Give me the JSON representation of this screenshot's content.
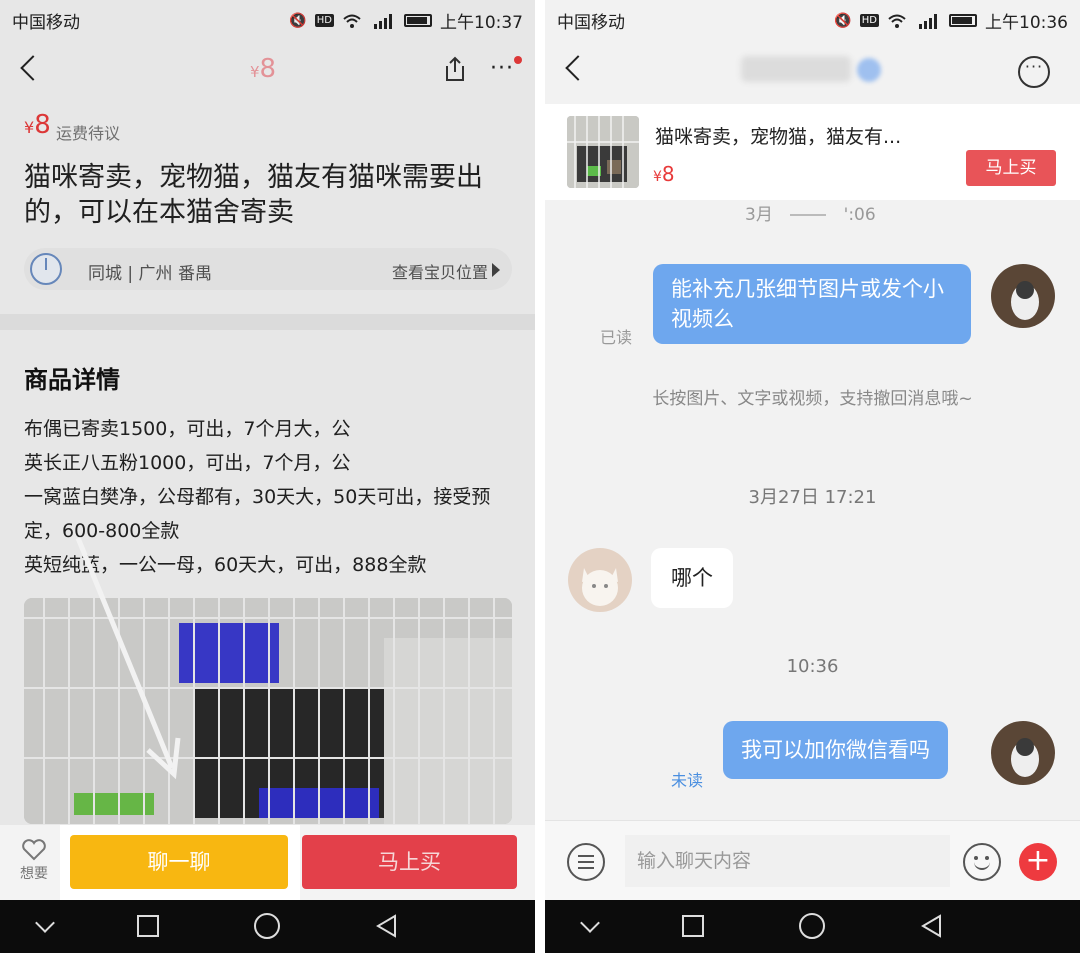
{
  "left": {
    "status": {
      "carrier": "中国移动",
      "time": "上午10:37",
      "hd": "HD",
      "signal": "⁴⁶"
    },
    "nav": {
      "price_symbol": "¥",
      "price": "8"
    },
    "product": {
      "price_symbol": "¥",
      "price": "8",
      "shipping": "运费待议",
      "title": "猫咪寄卖，宠物猫，猫友有猫咪需要出的，可以在本猫舍寄卖"
    },
    "location": {
      "text": "同城 | 广州 番禺",
      "link": "查看宝贝位置"
    },
    "details": {
      "heading": "商品详情",
      "lines": [
        "布偶已寄卖1500，可出，7个月大，公",
        "英长正八五粉1000，可出，7个月，公",
        "一窝蓝白樊净，公母都有，30天大，50天可出，接受预定，600-800全款",
        "英短纯蓝，一公一母，60天大，可出，888全款"
      ]
    },
    "bottom": {
      "want_label": "想要",
      "chat_label": "聊一聊",
      "buy_label": "马上买"
    }
  },
  "right": {
    "status": {
      "carrier": "中国移动",
      "time": "上午10:36",
      "hd": "HD",
      "signal": "⁴⁶"
    },
    "product_card": {
      "title": "猫咪寄卖，宠物猫，猫友有...",
      "price_symbol": "¥",
      "price": "8",
      "buy_label": "马上买"
    },
    "partial_time": "3月",
    "partial_time_tail": "':06",
    "messages": [
      {
        "side": "me",
        "text": "能补充几张细节图片或发个小视频么",
        "status": "已读"
      },
      {
        "side": "system",
        "text": "长按图片、文字或视频，支持撤回消息哦~"
      },
      {
        "side": "time",
        "text": "3月27日 17:21"
      },
      {
        "side": "other",
        "text": "哪个"
      },
      {
        "side": "time",
        "text": "10:36"
      },
      {
        "side": "me",
        "text": "我可以加你微信看吗",
        "status": "未读"
      }
    ],
    "input": {
      "placeholder": "输入聊天内容"
    }
  },
  "colors": {
    "accent_red": "#e83a3a",
    "chat_yellow": "#f8b711",
    "bubble_blue": "#6ea7ee",
    "read_gray": "#999999",
    "unread_blue": "#4a8fe0"
  },
  "icons": [
    "back-icon",
    "share-icon",
    "more-icon",
    "location-icon",
    "heart-icon",
    "menu-icon",
    "emoji-icon",
    "plus-icon"
  ]
}
